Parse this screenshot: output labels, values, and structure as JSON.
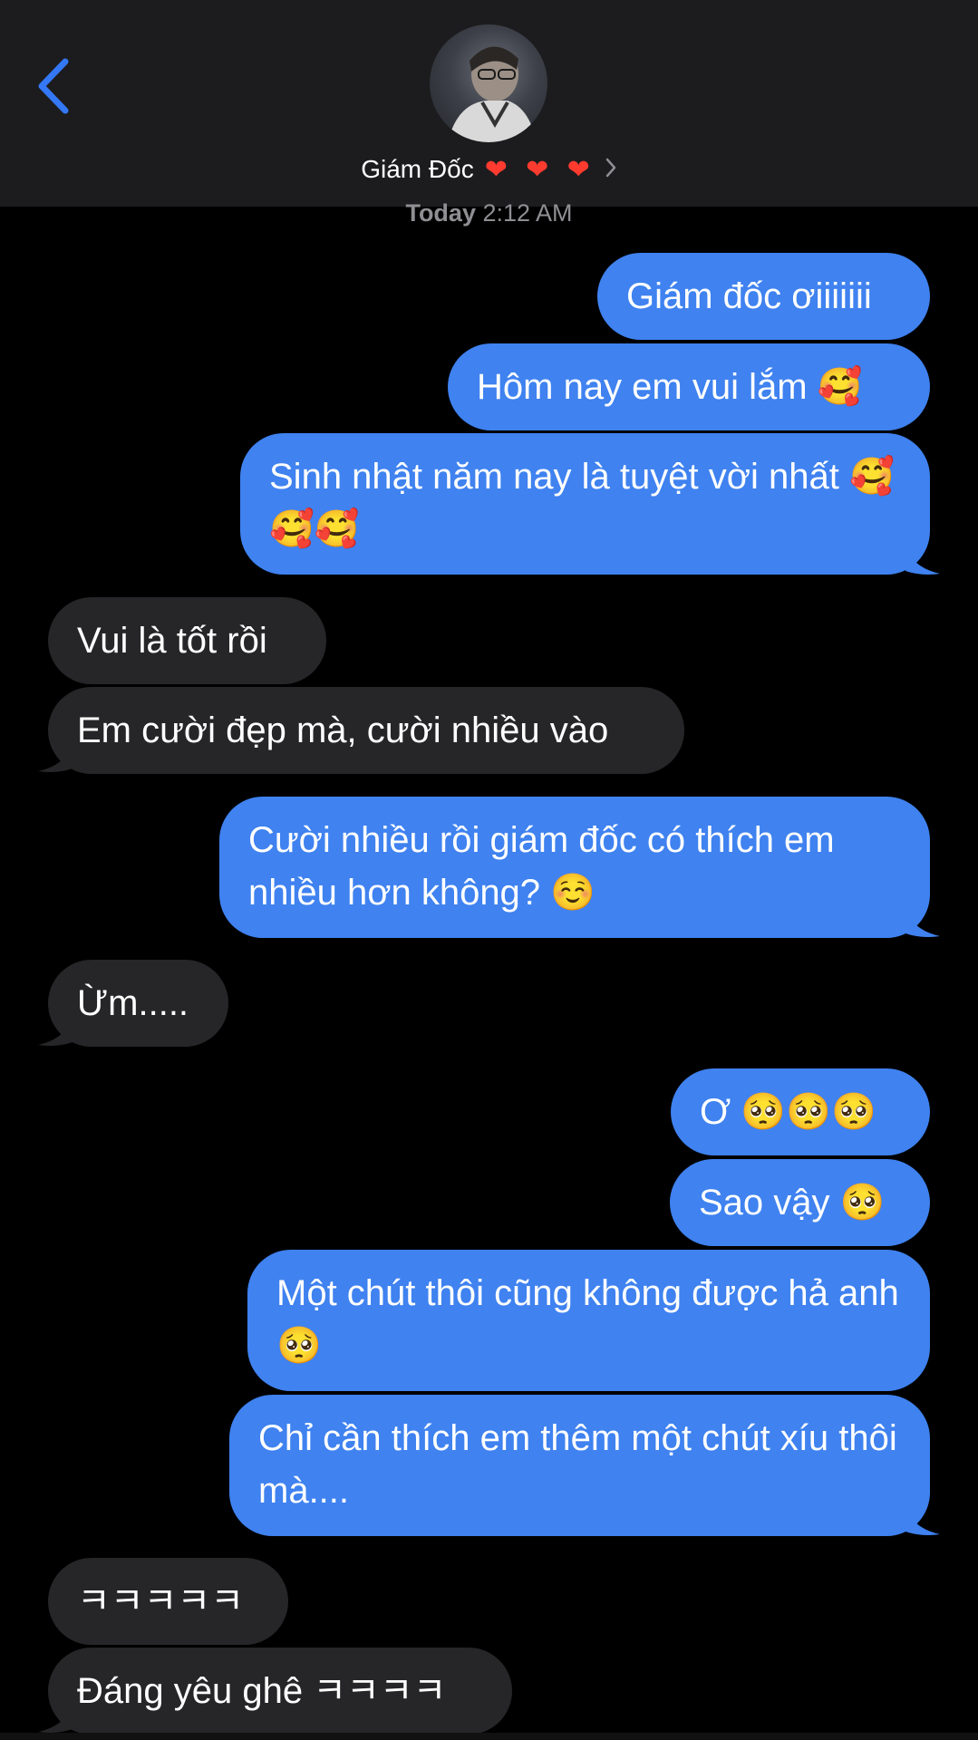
{
  "header": {
    "contact_name": "Giám Đốc",
    "hearts": "❤ ❤ ❤"
  },
  "timestamp": {
    "day": "Today",
    "time": "2:12 AM"
  },
  "messages": [
    {
      "from": "me",
      "text": "Giám đốc ơiiiiiii"
    },
    {
      "from": "me",
      "text": "Hôm nay em vui lắm 🥰"
    },
    {
      "from": "me",
      "text": "Sinh nhật năm nay là tuyệt vời nhất 🥰🥰🥰"
    },
    {
      "from": "them",
      "text": "Vui là tốt rồi"
    },
    {
      "from": "them",
      "text": "Em cười đẹp mà, cười nhiều vào"
    },
    {
      "from": "me",
      "text": "Cười nhiều rồi giám đốc có thích em nhiều hơn không? ☺️"
    },
    {
      "from": "them",
      "text": "Ừm....."
    },
    {
      "from": "me",
      "text": "Ơ 🥺🥺🥺"
    },
    {
      "from": "me",
      "text": "Sao vậy 🥺"
    },
    {
      "from": "me",
      "text": "Một chút thôi cũng không được hả anh 🥺"
    },
    {
      "from": "me",
      "text": "Chỉ cần thích em thêm một chút xíu thôi mà...."
    },
    {
      "from": "them",
      "text": "ㅋㅋㅋㅋㅋ"
    },
    {
      "from": "them",
      "text": "Đáng yêu ghê ㅋㅋㅋㅋ"
    }
  ],
  "colors": {
    "outgoing_bubble": "#3f82f0",
    "incoming_bubble": "#262628",
    "accent": "#3478f6"
  }
}
